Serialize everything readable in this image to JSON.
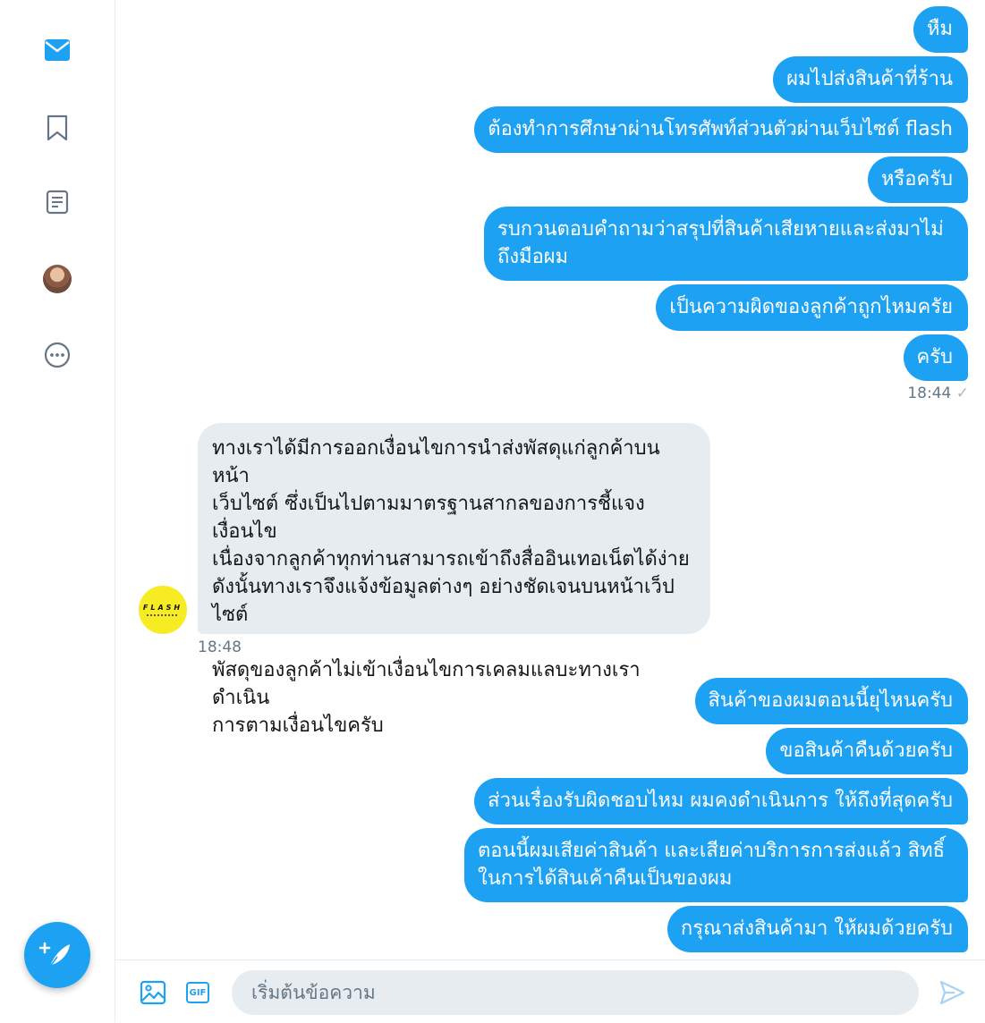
{
  "sidebar": {
    "items": [
      {
        "icon": "mail-icon",
        "active": true
      },
      {
        "icon": "bookmark-icon",
        "active": false
      },
      {
        "icon": "list-icon",
        "active": false
      },
      {
        "icon": "avatar",
        "active": false
      },
      {
        "icon": "more-icon",
        "active": false
      }
    ],
    "compose_icon": "compose-tweet-icon"
  },
  "conversation": {
    "outgoing_group_1": [
      "หืม",
      "ผมไปส่งสินค้าที่ร้าน",
      "ต้องทำการศึกษาผ่านโทรศัพท์ส่วนตัวผ่านเว็บไซต์ flash",
      "หรือครับ",
      "รบกวนตอบคำถามว่าสรุปที่สินค้าเสียหายและส่งมาไม่ถึงมือผม",
      "เป็นความผิดของลูกค้าถูกไหมครัย",
      "ครับ"
    ],
    "outgoing_group_1_time": "18:44",
    "incoming_message": "ทางเราได้มีการออกเงื่อนไขการนำส่งพัสดุแก่ลูกค้าบนหน้า\nเว็บไซต์ ซึ่งเป็นไปตามมาตรฐานสากลของการชี้แจงเงื่อนไข\nเนื่องจากลูกค้าทุกท่านสามารถเข้าถึงสื่ออินเทอเน็ตได้ง่าย\nดังนั้นทางเราจึงแจ้งข้อมูลต่างๆ อย่างชัดเจนบนหน้าเว็ปไซต์\n\nพัสดุของลูกค้าไม่เข้าเงื่อนไขการเคลมแลบะทางเราดำเนิน\nการตามเงื่อนไขครับ",
    "incoming_time": "18:48",
    "partner_avatar_text": "FLASH",
    "outgoing_group_2": [
      "สินค้าของผมตอนนี้ยุไหนครับ",
      "ขอสินค้าคืนด้วยครับ",
      "ส่วนเรื่องรับผิดชอบไหม ผมคงดำเนินการ ให้ถึงที่สุดครับ",
      "ตอนนี้ผมเสียค่าสินค้า และเสียค่าบริการการส่งแล้ว สิทธิ์ในการได้สินเค้าคืนเป็นของผม",
      "กรุณาส่งสินค้ามา ให้ผมด้วยครับ"
    ]
  },
  "composer": {
    "placeholder": "เริ่มต้นข้อความ",
    "gif_label": "GIF",
    "image_icon": "image-icon",
    "send_icon": "send-icon"
  },
  "colors": {
    "accent": "#1da1f2",
    "incoming_bubble": "#e6ecf0",
    "meta_text": "#657786"
  }
}
